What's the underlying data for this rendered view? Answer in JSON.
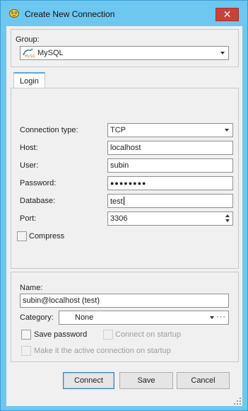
{
  "window": {
    "title": "Create New Connection",
    "close_glyph": "✕"
  },
  "group": {
    "label": "Group:",
    "value": "MySQL",
    "icon": "mysql-icon"
  },
  "tabs": [
    {
      "label": "Login",
      "selected": true
    }
  ],
  "login": {
    "connection_type": {
      "label": "Connection type:",
      "value": "TCP"
    },
    "host": {
      "label": "Host:",
      "value": "localhost"
    },
    "user": {
      "label": "User:",
      "value": "subin"
    },
    "password": {
      "label": "Password:",
      "value": "●●●●●●●●"
    },
    "database": {
      "label": "Database:",
      "value": "test"
    },
    "port": {
      "label": "Port:",
      "value": "3306"
    },
    "compress": {
      "label": "Compress",
      "checked": false
    }
  },
  "details": {
    "name": {
      "label": "Name:",
      "value": "subin@localhost (test)"
    },
    "category": {
      "label": "Category:",
      "value": "None",
      "more": "···"
    },
    "save_password": {
      "label": "Save password",
      "checked": false
    },
    "connect_on_startup": {
      "label": "Connect on startup",
      "checked": false,
      "enabled": false
    },
    "make_active": {
      "label": "Make it the active connection on startup",
      "checked": false,
      "enabled": false
    }
  },
  "buttons": {
    "connect": "Connect",
    "save": "Save",
    "cancel": "Cancel"
  },
  "colors": {
    "frame": "#6ec7f0",
    "client": "#f0f0f0",
    "close": "#c9423a",
    "tab_accent": "#5aa6e0"
  }
}
